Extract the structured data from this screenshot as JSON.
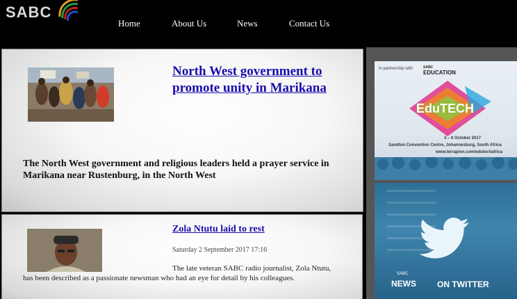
{
  "brand": {
    "logo_text": "SABC"
  },
  "nav": {
    "items": [
      "Home",
      "About Us",
      "News",
      "Contact Us"
    ]
  },
  "articles": [
    {
      "title": "North West government to promote unity in Marikana",
      "summary": "The North West government and religious leaders held a prayer service in Marikana near Rustenburg, in the North West",
      "thumb_icon": "crowd-photo-icon"
    },
    {
      "title": "Zola Ntutu laid to rest",
      "dateline": "Saturday 2 September 2017 17:16",
      "body": "The late veteran SABC radio journalist, Zola Ntutu, has been described as a passionate newsman who had an eye for detail by his colleagues.",
      "thumb_icon": "portrait-photo-icon"
    }
  ],
  "sidebar": {
    "edutech_ad": {
      "partner_text": "In partnership with",
      "partner_name": "EDUCATION",
      "partner_brand": "SABC",
      "brand": "EduTECH",
      "dates": "3 – 6 October 2017",
      "venue": "Sandton Convention Centre, Johannesburg, South Africa",
      "url": "www.terrapinn.com/edutechafrica"
    },
    "twitter_banner": {
      "sabc": "SABC",
      "news": "NEWS",
      "on_twitter": "ON TWITTER"
    }
  },
  "colors": {
    "link": "#1a0dab",
    "header_bg": "#000000",
    "sidebar_bg": "#555555"
  }
}
